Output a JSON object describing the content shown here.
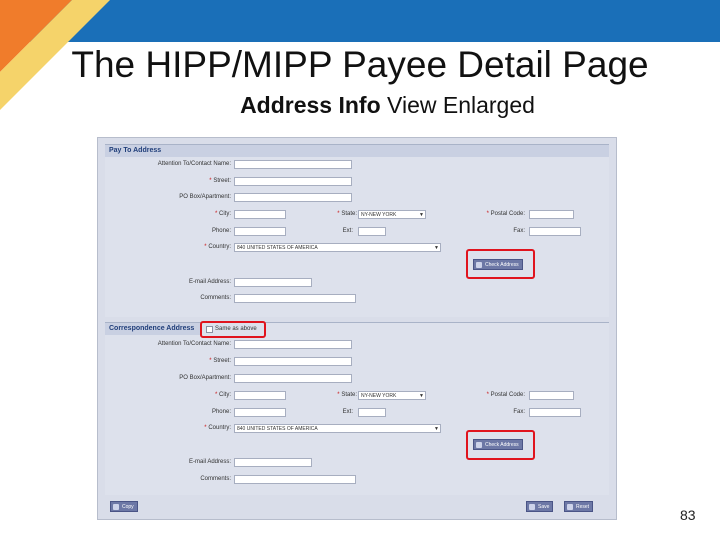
{
  "slide": {
    "title": "The HIPP/MIPP Payee Detail Page",
    "subtitle_bold": "Address Info",
    "subtitle_rest": " View Enlarged",
    "page_number": "83",
    "colors": {
      "top_bar": "#1a6fb8",
      "corner_orange": "#f07c2b",
      "corner_yellow": "#f5d36a",
      "highlight": "#e0141e"
    }
  },
  "screen": {
    "pay_to": {
      "header": "Pay To Address",
      "attention_label": "Attention To/Contact Name:",
      "street_label": "Street:",
      "po_label": "PO Box/Apartment:",
      "city_label": "City:",
      "state_label": "State:",
      "state_value": "NY-NEW YORK",
      "postal_label": "Postal Code:",
      "phone_label": "Phone:",
      "ext_label": "Ext:",
      "fax_label": "Fax:",
      "country_label": "Country:",
      "country_value": "840 UNITED STATES OF AMERICA",
      "check_address_label": "Check Address",
      "email_label": "E-mail Address:",
      "comments_label": "Comments:"
    },
    "correspondence": {
      "header": "Correspondence Address",
      "same_as_above_label": "Same as above",
      "attention_label": "Attention To/Contact Name:",
      "street_label": "Street:",
      "po_label": "PO Box/Apartment:",
      "city_label": "City:",
      "state_label": "State:",
      "state_value": "NY-NEW YORK",
      "postal_label": "Postal Code:",
      "phone_label": "Phone:",
      "ext_label": "Ext:",
      "fax_label": "Fax:",
      "country_label": "Country:",
      "country_value": "840 UNITED STATES OF AMERICA",
      "check_address_label": "Check Address",
      "email_label": "E-mail Address:",
      "comments_label": "Comments:"
    },
    "footer": {
      "copy_label": "Copy",
      "save_label": "Save",
      "reset_label": "Reset"
    },
    "required_marker": "*"
  }
}
